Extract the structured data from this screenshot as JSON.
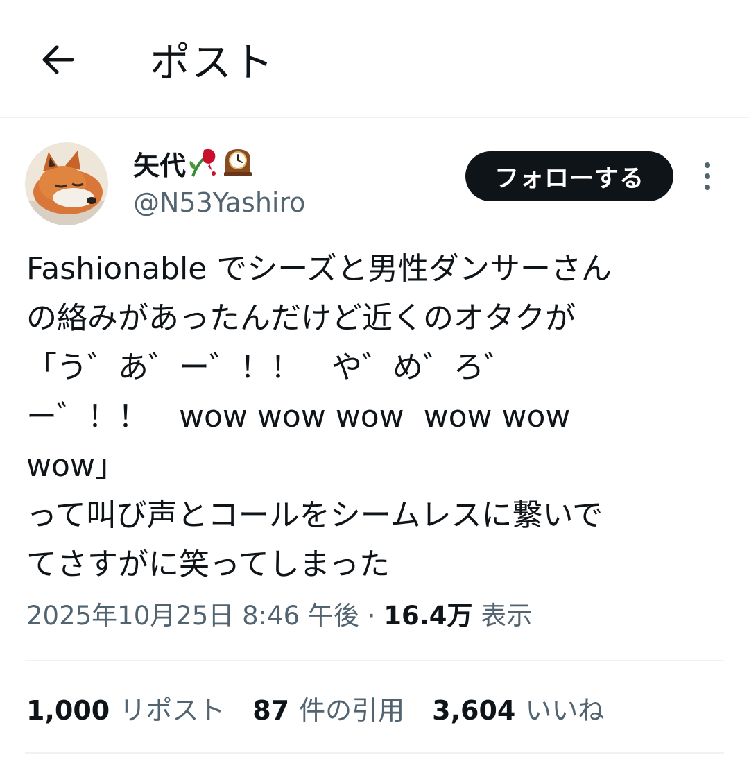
{
  "header": {
    "title": "ポスト"
  },
  "author": {
    "display_name": "矢代",
    "emojis": [
      "wilted-rose-icon",
      "mantelpiece-clock-icon"
    ],
    "handle": "@N53Yashiro"
  },
  "follow_label": "フォローする",
  "post": {
    "text": "Fashionable でシーズと男性ダンサーさん\nの絡みがあったんだけど近くのオタクが\n「う゛あ゛ー゛！！　や゛め゛ろ゛\nー゛！！　wow wow wow  wow wow\nwow」\nって叫び声とコールをシームレスに繋いで\nてさすがに笑ってしまった"
  },
  "meta": {
    "datetime": "2025年10月25日 8:46 午後",
    "separator": "·",
    "views_count": "16.4万",
    "views_label": "表示"
  },
  "stats": [
    {
      "count": "1,000",
      "label": "リポスト"
    },
    {
      "count": "87",
      "label": "件の引用"
    },
    {
      "count": "3,604",
      "label": "いいね"
    }
  ],
  "colors": {
    "text": "#0f1419",
    "secondary": "#536471",
    "divider": "#eff3f4",
    "button": "#0f1419"
  }
}
